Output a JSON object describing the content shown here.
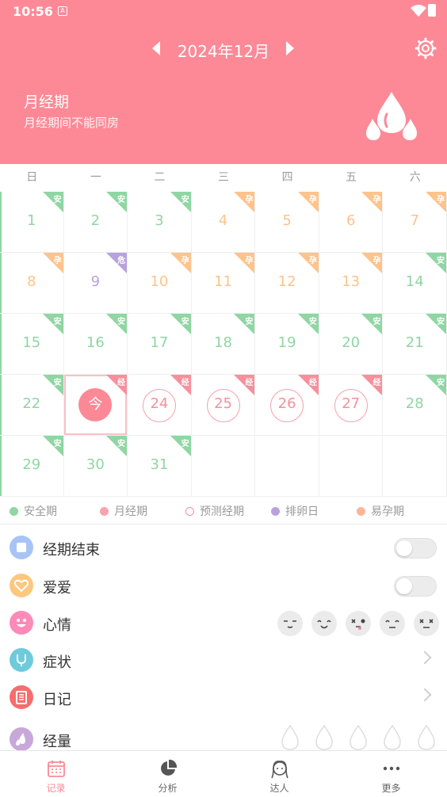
{
  "status_bar": {
    "time": "10:56",
    "badge": "A"
  },
  "header": {
    "month_title": "2024年12月",
    "period_title": "月经期",
    "period_subtitle": "月经期间不能同房"
  },
  "colors": {
    "brand": "#fd8996",
    "safe": "#8fd6a3",
    "fertile": "#fdc38c",
    "danger": "#b9a2dc",
    "period": "#f78f9c"
  },
  "weekdays": [
    "日",
    "一",
    "二",
    "三",
    "四",
    "五",
    "六"
  ],
  "calendar": [
    [
      {
        "d": "1",
        "t": "安",
        "k": "safe"
      },
      {
        "d": "2",
        "t": "安",
        "k": "safe"
      },
      {
        "d": "3",
        "t": "安",
        "k": "safe"
      },
      {
        "d": "4",
        "t": "孕",
        "k": "fertile"
      },
      {
        "d": "5",
        "t": "孕",
        "k": "fertile"
      },
      {
        "d": "6",
        "t": "孕",
        "k": "fertile"
      },
      {
        "d": "7",
        "t": "孕",
        "k": "fertile"
      }
    ],
    [
      {
        "d": "8",
        "t": "孕",
        "k": "fertile"
      },
      {
        "d": "9",
        "t": "危",
        "k": "danger"
      },
      {
        "d": "10",
        "t": "孕",
        "k": "fertile"
      },
      {
        "d": "11",
        "t": "孕",
        "k": "fertile"
      },
      {
        "d": "12",
        "t": "孕",
        "k": "fertile"
      },
      {
        "d": "13",
        "t": "孕",
        "k": "fertile"
      },
      {
        "d": "14",
        "t": "安",
        "k": "safe"
      }
    ],
    [
      {
        "d": "15",
        "t": "安",
        "k": "safe"
      },
      {
        "d": "16",
        "t": "安",
        "k": "safe"
      },
      {
        "d": "17",
        "t": "安",
        "k": "safe"
      },
      {
        "d": "18",
        "t": "安",
        "k": "safe"
      },
      {
        "d": "19",
        "t": "安",
        "k": "safe"
      },
      {
        "d": "20",
        "t": "安",
        "k": "safe"
      },
      {
        "d": "21",
        "t": "安",
        "k": "safe"
      }
    ],
    [
      {
        "d": "22",
        "t": "安",
        "k": "safe"
      },
      {
        "d": "今",
        "t": "经",
        "k": "today"
      },
      {
        "d": "24",
        "t": "经",
        "k": "period"
      },
      {
        "d": "25",
        "t": "经",
        "k": "period"
      },
      {
        "d": "26",
        "t": "经",
        "k": "period"
      },
      {
        "d": "27",
        "t": "经",
        "k": "period"
      },
      {
        "d": "28",
        "t": "安",
        "k": "safe"
      }
    ],
    [
      {
        "d": "29",
        "t": "安",
        "k": "safe"
      },
      {
        "d": "30",
        "t": "安",
        "k": "safe"
      },
      {
        "d": "31",
        "t": "安",
        "k": "safe"
      },
      {
        "d": "",
        "t": "",
        "k": "empty"
      },
      {
        "d": "",
        "t": "",
        "k": "empty"
      },
      {
        "d": "",
        "t": "",
        "k": "empty"
      },
      {
        "d": "",
        "t": "",
        "k": "empty"
      }
    ]
  ],
  "legend": [
    {
      "label": "安全期",
      "kind": "safe"
    },
    {
      "label": "月经期",
      "kind": "period"
    },
    {
      "label": "预测经期",
      "kind": "predicted"
    },
    {
      "label": "排卵日",
      "kind": "danger"
    },
    {
      "label": "易孕期",
      "kind": "fertile"
    }
  ],
  "records": {
    "period_end": "经期结束",
    "love": "爱爱",
    "mood": "心情",
    "symptoms": "症状",
    "diary": "日记",
    "flow": "经量"
  },
  "tabs": [
    {
      "label": "记录",
      "icon": "calendar-icon"
    },
    {
      "label": "分析",
      "icon": "pie-chart-icon"
    },
    {
      "label": "达人",
      "icon": "girl-avatar-icon"
    },
    {
      "label": "更多",
      "icon": "more-dots-icon"
    }
  ]
}
